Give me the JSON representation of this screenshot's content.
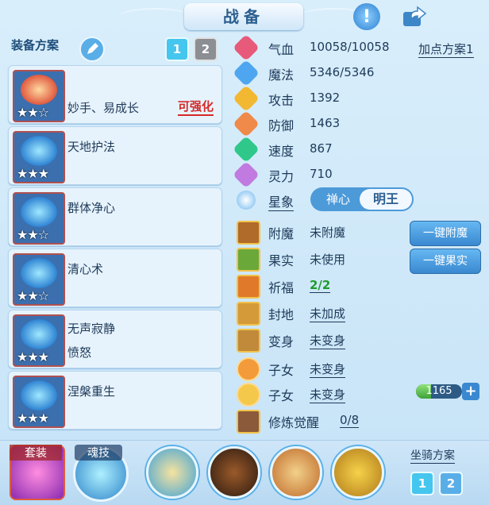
{
  "header": {
    "title": "战备",
    "alert_icon": "exclamation-icon",
    "share_icon": "share-icon"
  },
  "left": {
    "title": "装备方案",
    "pages": [
      "1",
      "2"
    ],
    "schemes": [
      {
        "name": "妙手、易成长",
        "badge": "可强化",
        "stars": "★★☆"
      },
      {
        "name": "天地护法",
        "stars": "★★★"
      },
      {
        "name": "群体净心",
        "stars": "★★☆"
      },
      {
        "name": "清心术",
        "stars": "★★☆"
      },
      {
        "name": "无声寂静",
        "sub": "愤怒",
        "stars": "★★★"
      },
      {
        "name": "涅槃重生",
        "stars": "★★★"
      }
    ]
  },
  "stats": {
    "plan_link": "加点方案1",
    "rows": [
      {
        "label": "气血",
        "value": "10058/10058"
      },
      {
        "label": "魔法",
        "value": "5346/5346"
      },
      {
        "label": "攻击",
        "value": "1392"
      },
      {
        "label": "防御",
        "value": "1463"
      },
      {
        "label": "速度",
        "value": "867"
      },
      {
        "label": "灵力",
        "value": "710"
      }
    ],
    "xingxiang": {
      "label": "星象",
      "options": [
        "禅心",
        "明王"
      ],
      "selected": "明王"
    }
  },
  "extras": [
    {
      "label": "附魔",
      "value": "未附魔"
    },
    {
      "label": "果实",
      "value": "未使用"
    },
    {
      "label": "祈福",
      "value": "2/2"
    },
    {
      "label": "封地",
      "value": "未加成"
    },
    {
      "label": "变身",
      "value": "未变身"
    },
    {
      "label": "子女",
      "value": "未变身"
    },
    {
      "label": "子女",
      "value": "未变身"
    },
    {
      "label": "修炼觉醒",
      "value": "0/8"
    }
  ],
  "buttons": {
    "enchant_all": "一键附魔",
    "fruit_all": "一键果实"
  },
  "xp": {
    "value": "1165",
    "fill_fraction": 0.32
  },
  "bottom": {
    "gear_label": "套装",
    "soul_label": "魂技",
    "mount_title": "坐骑方案",
    "mount_pages": [
      "1",
      "2"
    ]
  },
  "colors": {
    "accent": "#3a88d0",
    "warning": "#d52a2a",
    "positive": "#1f9a2a"
  }
}
